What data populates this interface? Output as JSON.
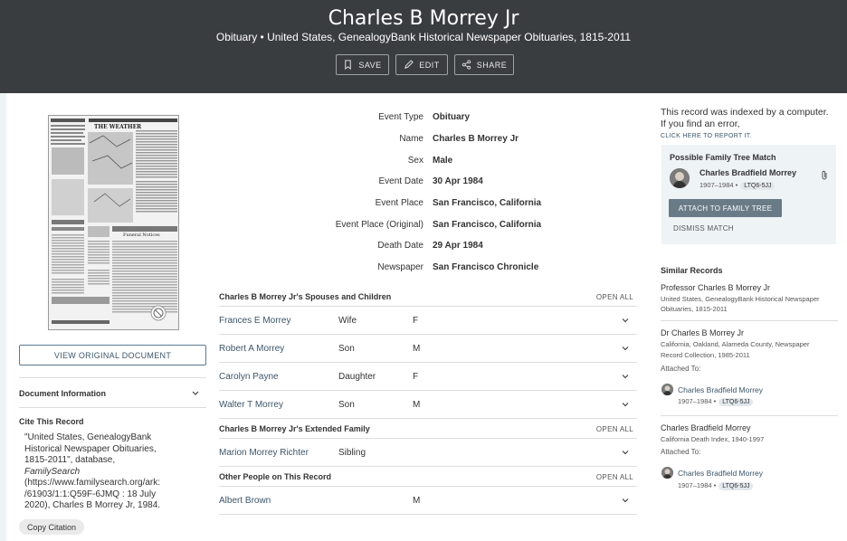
{
  "header": {
    "title": "Charles B Morrey Jr",
    "subtitle": "Obituary • United States, GenealogyBank Historical Newspaper Obituaries, 1815-2011",
    "save": "SAVE",
    "edit": "EDIT",
    "share": "SHARE"
  },
  "left": {
    "view_original": "VIEW ORIGINAL DOCUMENT",
    "doc_info": "Document Information",
    "cite_title": "Cite This Record",
    "cite_lines": [
      "\"United States, GenealogyBank",
      "Historical Newspaper Obituaries,",
      "1815-2011\", database,",
      "FamilySearch",
      "(https://www.familysearch.org/ark:",
      "/61903/1:1:Q59F-6JMQ : 18 July",
      "2020), Charles B Morrey Jr, 1984."
    ],
    "copy": "Copy Citation",
    "thumb_heading": "THE WEATHER",
    "thumb_notices": "Funeral Notices"
  },
  "facts": [
    {
      "k": "Event Type",
      "v": "Obituary"
    },
    {
      "k": "Name",
      "v": "Charles B Morrey Jr"
    },
    {
      "k": "Sex",
      "v": "Male"
    },
    {
      "k": "Event Date",
      "v": "30 Apr 1984"
    },
    {
      "k": "Event Place",
      "v": "San Francisco, California"
    },
    {
      "k": "Event Place (Original)",
      "v": "San Francisco, California"
    },
    {
      "k": "Death Date",
      "v": "29 Apr 1984"
    },
    {
      "k": "Newspaper",
      "v": "San Francisco Chronicle"
    }
  ],
  "spouses": {
    "title": "Charles B Morrey Jr's Spouses and Children",
    "open_all": "OPEN ALL",
    "rows": [
      {
        "name": "Frances E Morrey",
        "rel": "Wife",
        "sex": "F"
      },
      {
        "name": "Robert A Morrey",
        "rel": "Son",
        "sex": "M"
      },
      {
        "name": "Carolyn Payne",
        "rel": "Daughter",
        "sex": "F"
      },
      {
        "name": "Walter T Morrey",
        "rel": "Son",
        "sex": "M"
      }
    ]
  },
  "extended": {
    "title": "Charles B Morrey Jr's Extended Family",
    "open_all": "OPEN ALL",
    "rows": [
      {
        "name": "Marion Morrey Richter",
        "rel": "Sibling",
        "sex": ""
      }
    ]
  },
  "others": {
    "title": "Other People on This Record",
    "open_all": "OPEN ALL",
    "rows": [
      {
        "name": "Albert Brown",
        "rel": "",
        "sex": "M"
      }
    ]
  },
  "right": {
    "indexed_1": "This record was indexed by a computer.",
    "indexed_2": "If you find an error,",
    "report": "CLICK HERE TO REPORT IT.",
    "match_title": "Possible Family Tree Match",
    "match_name": "Charles Bradfield Morrey",
    "match_dates": "1907–1984 •",
    "match_id": "LTQ6-5JJ",
    "attach": "ATTACH TO FAMILY TREE",
    "dismiss": "DISMISS MATCH",
    "similar_title": "Similar Records",
    "similar": [
      {
        "title": "Professor Charles B Morrey Jr",
        "sub1": "United States, GenealogyBank Historical Newspaper",
        "sub2": "Obituaries, 1815-2011"
      },
      {
        "title": "Dr Charles B Morrey Jr",
        "sub1": "California, Oakland, Alameda County, Newspaper",
        "sub2": "Record Collection, 1985-2011",
        "attached": "Attached To:",
        "person": "Charles Bradfield Morrey",
        "dates": "1907–1984 •",
        "pid": "LTQ6-5JJ"
      },
      {
        "title": "Charles Bradfield Morrey",
        "sub1": "California Death Index, 1940-1997",
        "sub2": "",
        "attached": "Attached To:",
        "person": "Charles Bradfield Morrey",
        "dates": "1907–1984 •",
        "pid": "LTQ6-5JJ"
      }
    ]
  }
}
